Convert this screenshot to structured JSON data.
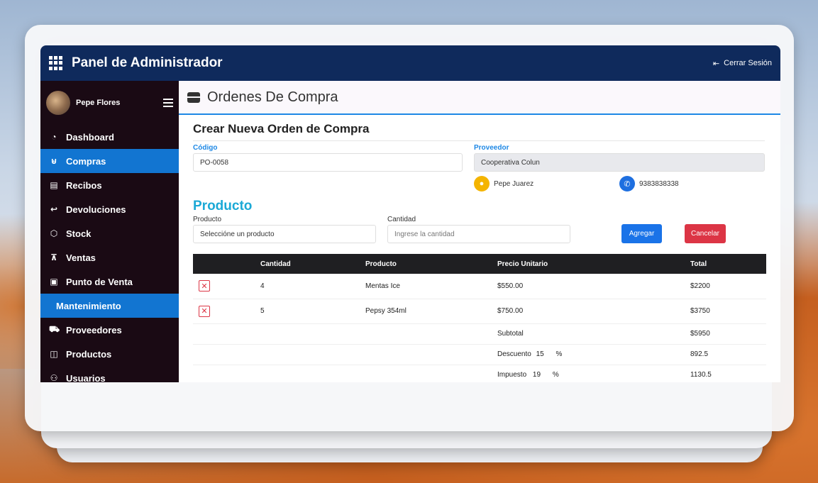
{
  "app": {
    "title": "Panel de Administrador",
    "logout_label": "Cerrar Sesión"
  },
  "user": {
    "name": "Pepe Flores"
  },
  "sidebar": {
    "items": [
      {
        "label": "Dashboard",
        "icon": "gauge-icon"
      },
      {
        "label": "Compras",
        "icon": "basket-icon"
      },
      {
        "label": "Recibos",
        "icon": "receipt-icon"
      },
      {
        "label": "Devoluciones",
        "icon": "return-icon"
      },
      {
        "label": "Stock",
        "icon": "box-icon"
      },
      {
        "label": "Ventas",
        "icon": "cart-icon"
      },
      {
        "label": "Punto de Venta",
        "icon": "register-icon"
      },
      {
        "label": "Mantenimiento",
        "icon": ""
      },
      {
        "label": "Proveedores",
        "icon": "truck-icon"
      },
      {
        "label": "Productos",
        "icon": "bag-icon"
      },
      {
        "label": "Usuarios",
        "icon": "users-icon"
      }
    ],
    "active": "Compras"
  },
  "page": {
    "title": "Ordenes De Compra"
  },
  "form": {
    "heading": "Crear Nueva Orden de Compra",
    "codigo_label": "Código",
    "codigo_value": "PO-0058",
    "proveedor_label": "Proveedor",
    "proveedor_value": "Cooperativa Colun",
    "contact_name": "Pepe Juarez",
    "contact_phone": "9383838338"
  },
  "producto": {
    "section_title": "Producto",
    "producto_label": "Producto",
    "producto_placeholder": "Seleccióne un producto",
    "cantidad_label": "Cantidad",
    "cantidad_placeholder": "Ingrese la cantidad",
    "add_button": "Agregar",
    "cancel_button": "Cancelar"
  },
  "table": {
    "headers": [
      "",
      "Cantidad",
      "Producto",
      "Precio Unitario",
      "Total"
    ],
    "rows": [
      {
        "cantidad": "4",
        "producto": "Mentas Ice",
        "precio": "$550.00",
        "total": "$2200"
      },
      {
        "cantidad": "5",
        "producto": "Pepsy 354ml",
        "precio": "$750.00",
        "total": "$3750"
      }
    ],
    "subtotal_label": "Subtotal",
    "subtotal_value": "$5950",
    "descuento_label": "Descuento",
    "descuento_pct": "15",
    "descuento_value": "892.5",
    "impuesto_label": "Impuesto",
    "impuesto_pct": "19",
    "impuesto_value": "1130.5",
    "pct_symbol": "%"
  },
  "colors": {
    "topbar": "#0f2a5c",
    "sidebar": "#1a0a14",
    "active": "#1275d1",
    "accent": "#1ba9d6",
    "danger": "#dc3545"
  }
}
